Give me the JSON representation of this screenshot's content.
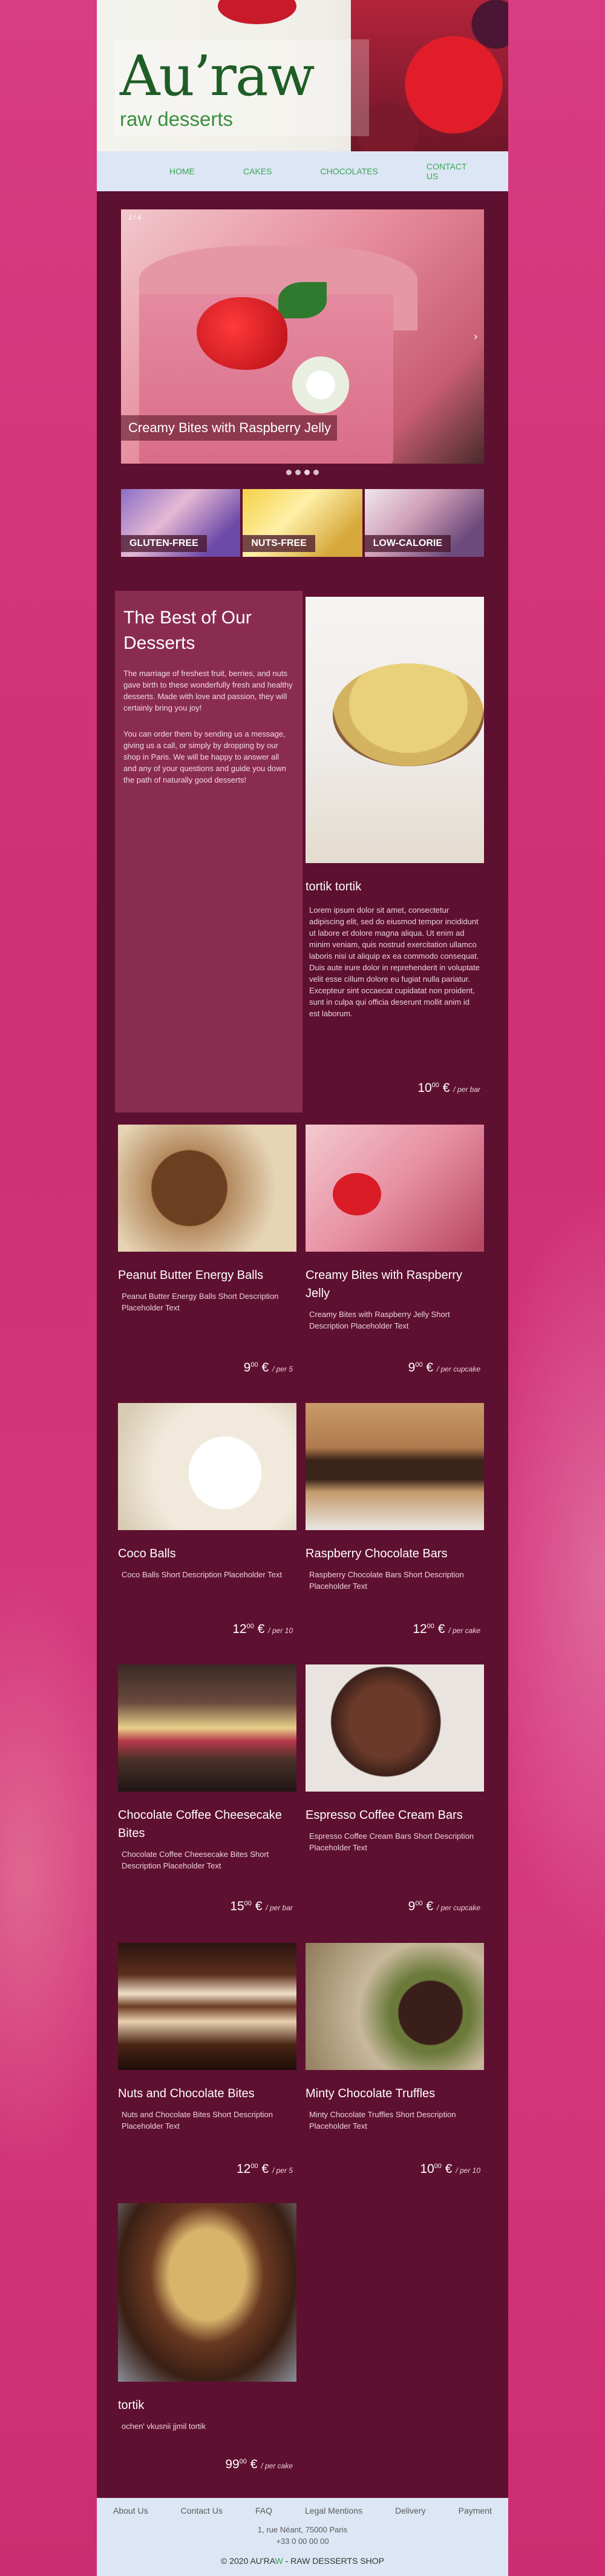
{
  "brand": {
    "logo_title": "Au’raw",
    "logo_subtitle": "raw desserts"
  },
  "nav": {
    "items": [
      "HOME",
      "CAKES",
      "CHOCOLATES",
      "CONTACT US"
    ]
  },
  "slider": {
    "counter": "2 / 4",
    "caption": "Creamy Bites with Raspberry Jelly",
    "next_icon": "›",
    "dots": 4,
    "active_dot": 3
  },
  "categories": [
    {
      "label": "GLUTEN-FREE"
    },
    {
      "label": "NUTS-FREE"
    },
    {
      "label": "LOW-CALORIE"
    }
  ],
  "intro": {
    "title": "The Best of Our Desserts",
    "p1": "The marriage of freshest fruit, berries, and nuts gave birth to these wonderfully fresh and healthy desserts. Made with love and passion, they will certainly bring you joy!",
    "p2": "You can order them by sending us a message, giving us a call, or simply by dropping by our shop in Paris. We will be happy to answer all and any of your questions and guide you down the path of naturally good desserts!"
  },
  "featured": {
    "title": "tortik tortik",
    "desc": "Lorem ipsum dolor sit amet, consectetur adipiscing elit, sed do eiusmod tempor incididunt ut labore et dolore magna aliqua. Ut enim ad minim veniam, quis nostrud exercitation ullamco laboris nisi ut aliquip ex ea commodo consequat. Duis aute irure dolor in reprehenderit in voluptate velit esse cillum dolore eu fugiat nulla pariatur. Excepteur sint occaecat cupidatat non proident, sunt in culpa qui officia deserunt mollit anim id est laborum.",
    "price_int": "10",
    "price_dec": "00",
    "currency": "€",
    "per": "/ per bar"
  },
  "products": [
    {
      "title": "Peanut Butter Energy Balls",
      "desc": "Peanut Butter Energy Balls Short Description Placeholder Text",
      "price_int": "9",
      "price_dec": "00",
      "currency": "€",
      "per": "/ per 5"
    },
    {
      "title": "Creamy Bites with Raspberry Jelly",
      "desc": "Creamy Bites with Raspberry Jelly Short Description Placeholder Text",
      "price_int": "9",
      "price_dec": "00",
      "currency": "€",
      "per": "/ per cupcake"
    },
    {
      "title": "Coco Balls",
      "desc": "Coco Balls Short Description Placeholder Text",
      "price_int": "12",
      "price_dec": "00",
      "currency": "€",
      "per": "/ per 10"
    },
    {
      "title": "Raspberry Chocolate Bars",
      "desc": "Raspberry Chocolate Bars Short Description Placeholder Text",
      "price_int": "12",
      "price_dec": "00",
      "currency": "€",
      "per": "/ per cake"
    },
    {
      "title": "Chocolate Coffee Cheesecake Bites",
      "desc": "Chocolate Coffee Cheesecake Bites Short Description Placeholder Text",
      "price_int": "15",
      "price_dec": "00",
      "currency": "€",
      "per": "/ per bar"
    },
    {
      "title": "Espresso Coffee Cream Bars",
      "desc": "Espresso Coffee Cream Bars Short Description Placeholder Text",
      "price_int": "9",
      "price_dec": "00",
      "currency": "€",
      "per": "/ per cupcake"
    },
    {
      "title": "Nuts and Chocolate Bites",
      "desc": "Nuts and Chocolate Bites Short Description Placeholder Text",
      "price_int": "12",
      "price_dec": "00",
      "currency": "€",
      "per": "/ per 5"
    },
    {
      "title": "Minty Chocolate Truffles",
      "desc": "Minty Chocolate Truffles Short Description Placeholder Text",
      "price_int": "10",
      "price_dec": "00",
      "currency": "€",
      "per": "/ per 10"
    },
    {
      "title": "tortik",
      "desc": "ochen' vkusnii jjmil tortik",
      "price_int": "99",
      "price_dec": "00",
      "currency": "€",
      "per": "/ per cake"
    }
  ],
  "footer": {
    "links": [
      "About Us",
      "Contact Us",
      "FAQ",
      "Legal Mentions",
      "Delivery",
      "Payment"
    ],
    "address": "1, rue Néant, 75000 Paris",
    "phone": "+33 0 00 00 00",
    "copyright_prefix": "© 2020 AU'RA",
    "copyright_accent": "W",
    "copyright_suffix": " - RAW DESSERTS SHOP"
  },
  "colors": {
    "page_bg": "#d6347a",
    "content_bg": "#5e1030",
    "intro_bg": "#8a2c50",
    "nav_bg": "#dce6f4",
    "accent_green": "#3aa655",
    "logo_green": "#1f5d27"
  }
}
